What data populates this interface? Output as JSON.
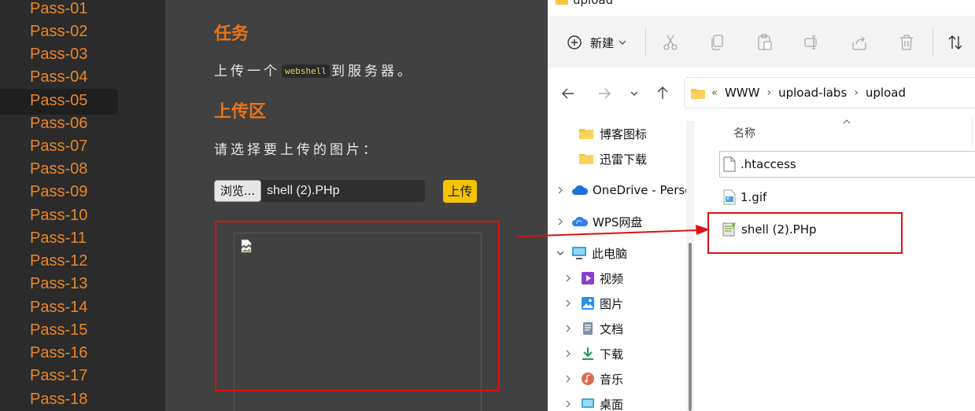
{
  "sidebar": {
    "items": [
      "Pass-01",
      "Pass-02",
      "Pass-03",
      "Pass-04",
      "Pass-05",
      "Pass-06",
      "Pass-07",
      "Pass-08",
      "Pass-09",
      "Pass-10",
      "Pass-11",
      "Pass-12",
      "Pass-13",
      "Pass-14",
      "Pass-15",
      "Pass-16",
      "Pass-17",
      "Pass-18"
    ],
    "active": "Pass-05"
  },
  "task": {
    "heading": "任务",
    "text_before": "上传一个",
    "code": "webshell",
    "text_after": "到服务器。"
  },
  "upload": {
    "heading": "上传区",
    "prompt": "请选择要上传的图片：",
    "browse_label": "浏览...",
    "selected_file": "shell (2).PHp",
    "submit_label": "上传"
  },
  "colors": {
    "accent_orange": "#e8741a",
    "upload_button": "#f5c400",
    "highlight_red": "#e01010"
  },
  "explorer": {
    "title": "upload",
    "toolbar": {
      "new_label": "新建"
    },
    "breadcrumb": [
      "WWW",
      "upload-labs",
      "upload"
    ],
    "nav_items": [
      {
        "label": "博客图标",
        "icon": "folder-icon"
      },
      {
        "label": "迅雷下载",
        "icon": "folder-icon"
      },
      {
        "label": "OneDrive - Perso",
        "icon": "onedrive-icon"
      },
      {
        "label": "WPS网盘",
        "icon": "wps-cloud-icon"
      },
      {
        "label": "此电脑",
        "icon": "pc-icon"
      },
      {
        "label": "视频",
        "icon": "video-icon"
      },
      {
        "label": "图片",
        "icon": "pictures-icon"
      },
      {
        "label": "文档",
        "icon": "documents-icon"
      },
      {
        "label": "下载",
        "icon": "download-icon"
      },
      {
        "label": "音乐",
        "icon": "music-icon"
      },
      {
        "label": "桌面",
        "icon": "desktop-icon"
      }
    ],
    "column_header": "名称",
    "files": [
      {
        "name": ".htaccess",
        "icon": "file-icon"
      },
      {
        "name": "1.gif",
        "icon": "gif-icon"
      },
      {
        "name": "shell (2).PHp",
        "icon": "php-icon"
      }
    ]
  }
}
